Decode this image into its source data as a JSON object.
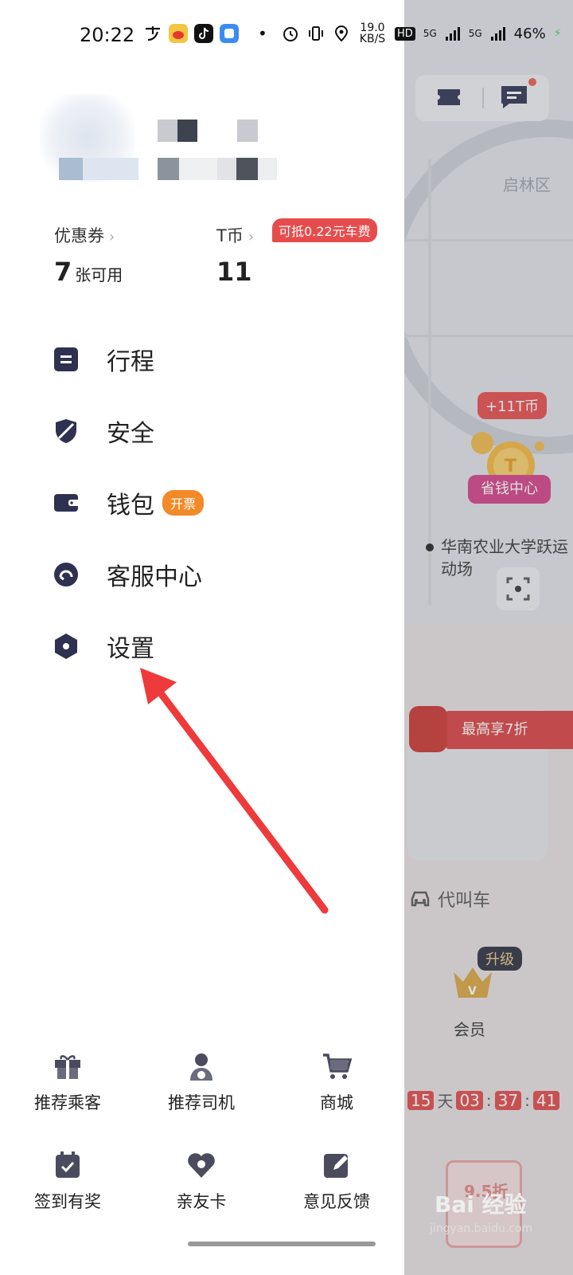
{
  "status_bar": {
    "time": "20:22",
    "dot": "•",
    "net_speed": "19.0 KB/S",
    "hd": "HD",
    "sim1": "5G",
    "sim2": "5G",
    "battery": "46%"
  },
  "account": {
    "coupon_label": "优惠券",
    "coupon_count": "7",
    "coupon_unit": "张可用",
    "tcoin_label": "T币",
    "tcoin_value": "11",
    "tcoin_tag": "可抵0.22元车费"
  },
  "menu": {
    "trips": "行程",
    "safety": "安全",
    "wallet": "钱包",
    "wallet_tag": "开票",
    "service": "客服中心",
    "settings": "设置"
  },
  "grid": {
    "refer_passenger": "推荐乘客",
    "refer_driver": "推荐司机",
    "mall": "商城",
    "checkin": "签到有奖",
    "family_card": "亲友卡",
    "feedback": "意见反馈"
  },
  "background": {
    "map_label": "启林区",
    "promo_badge": "+11T币",
    "promo_label": "省钱中心",
    "poi_name": "华南农业大学跃运动场",
    "discount_text": "最高享7折",
    "proxy_car": "代叫车",
    "upgrade": "升级",
    "member": "会员",
    "countdown_days": "15",
    "countdown_day_unit": "天",
    "countdown_h": "03",
    "countdown_m": "37",
    "countdown_s": "41",
    "coupon_rate": "9.5折",
    "watermark": "Bai 经验",
    "watermark_sub": "jingyan.baidu.com"
  },
  "colors": {
    "accent_red": "#e74c4c",
    "invoice_orange": "#f28a28",
    "icon_navy": "#2f3150",
    "annotation_arrow": "#ee3a3a"
  }
}
